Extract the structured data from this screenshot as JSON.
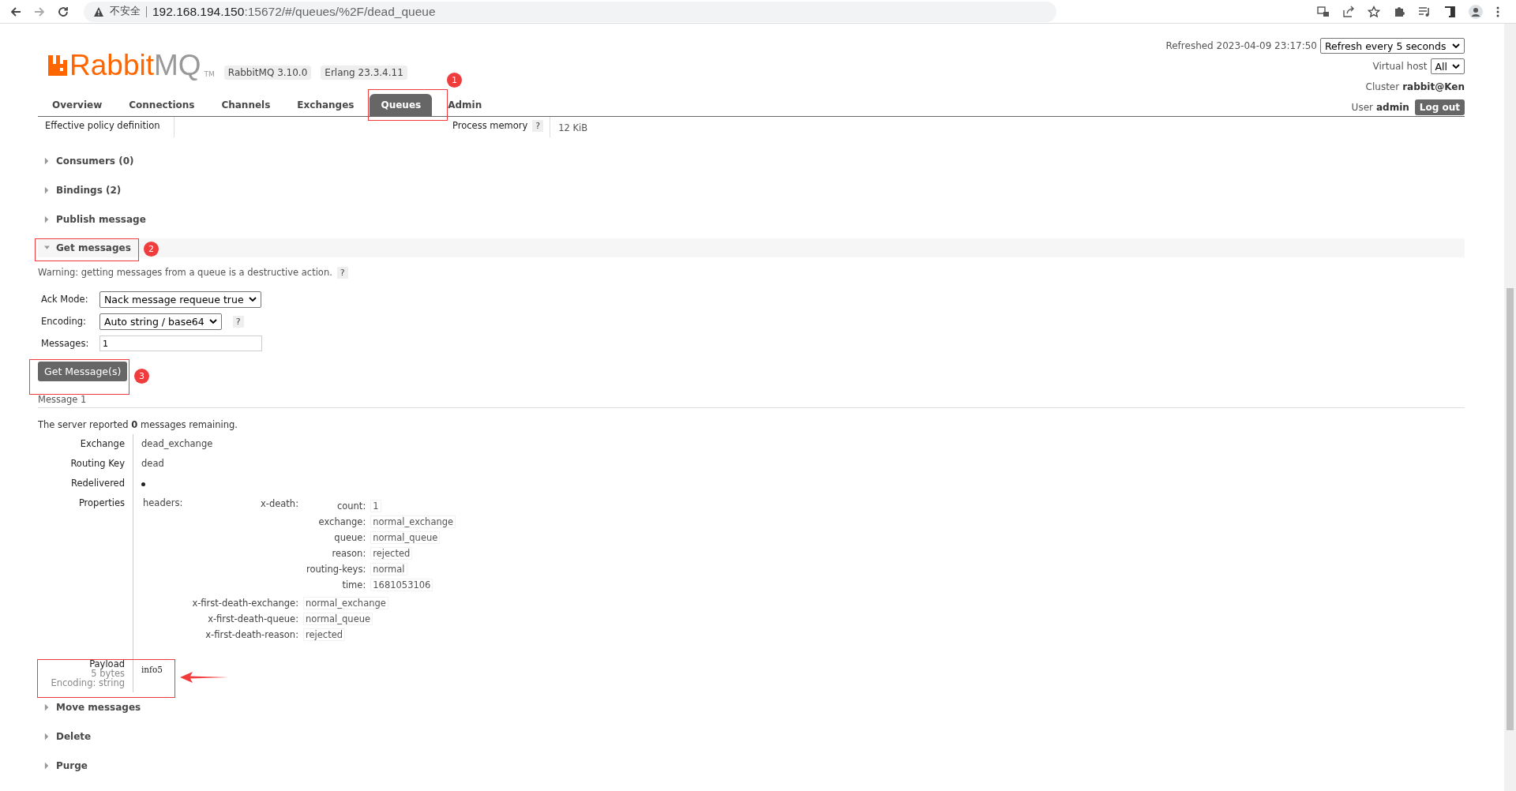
{
  "browser": {
    "security": "不安全",
    "url_host": "192.168.194.150",
    "url_rest": ":15672/#/queues/%2F/dead_queue"
  },
  "header": {
    "logo_main": "Rabbit",
    "logo_accent": "MQ",
    "logo_tm": "TM",
    "versions": [
      "RabbitMQ 3.10.0",
      "Erlang 23.3.4.11"
    ],
    "refreshed": "Refreshed 2023-04-09 23:17:50",
    "refresh_select": "Refresh every 5 seconds",
    "vhost_label": "Virtual host",
    "vhost": "All",
    "cluster_label": "Cluster",
    "cluster": "rabbit@Ken",
    "user_label": "User",
    "user": "admin",
    "logout": "Log out"
  },
  "tabs": [
    {
      "label": "Overview",
      "selected": false
    },
    {
      "label": "Connections",
      "selected": false
    },
    {
      "label": "Channels",
      "selected": false
    },
    {
      "label": "Exchanges",
      "selected": false
    },
    {
      "label": "Queues",
      "selected": true
    },
    {
      "label": "Admin",
      "selected": false
    }
  ],
  "details_row": {
    "label": "Effective policy definition",
    "memory_label": "Process memory",
    "help": "?",
    "memory": "12 KiB"
  },
  "sections_before": [
    {
      "title": "Consumers (0)",
      "expanded": false
    },
    {
      "title": "Bindings (2)",
      "expanded": false
    },
    {
      "title": "Publish message",
      "expanded": false
    }
  ],
  "get_messages": {
    "title": "Get messages",
    "expanded": true,
    "warning": "Warning: getting messages from a queue is a destructive action.",
    "help": "?",
    "ack_mode_label": "Ack Mode:",
    "ack_mode": "Nack message requeue true",
    "encoding_label": "Encoding:",
    "encoding": "Auto string / base64",
    "encoding_help": "?",
    "messages_label": "Messages:",
    "messages": "1",
    "button": "Get Message(s)"
  },
  "message": {
    "title": "Message 1",
    "remaining": "The server reported **0** messages remaining.",
    "fields": [
      {
        "label": "Exchange",
        "value": "dead_exchange"
      },
      {
        "label": "Routing Key",
        "value": "dead"
      }
    ],
    "redelivered_label": "Redelivered",
    "redelivered": true,
    "properties_label": "Properties",
    "properties": {
      "key": "headers:",
      "entries": [
        {
          "key": "x-death:",
          "entries": [
            {
              "key": "count:",
              "value": "1"
            },
            {
              "key": "exchange:",
              "value": "normal_exchange"
            },
            {
              "key": "queue:",
              "value": "normal_queue"
            },
            {
              "key": "reason:",
              "value": "rejected"
            },
            {
              "key": "routing-keys:",
              "value": "normal"
            },
            {
              "key": "time:",
              "value": "1681053106"
            }
          ]
        },
        {
          "key": "x-first-death-exchange:",
          "value": "normal_exchange"
        },
        {
          "key": "x-first-death-queue:",
          "value": "normal_queue"
        },
        {
          "key": "x-first-death-reason:",
          "value": "rejected"
        }
      ]
    },
    "payload_label": "Payload",
    "payload_size": "5 bytes",
    "payload_encoding": "Encoding: string",
    "payload": "info5"
  },
  "sections_after": [
    {
      "title": "Move messages",
      "expanded": false
    },
    {
      "title": "Delete",
      "expanded": false
    },
    {
      "title": "Purge",
      "expanded": false
    }
  ],
  "annotations": [
    {
      "number": "1"
    },
    {
      "number": "2"
    },
    {
      "number": "3"
    }
  ]
}
